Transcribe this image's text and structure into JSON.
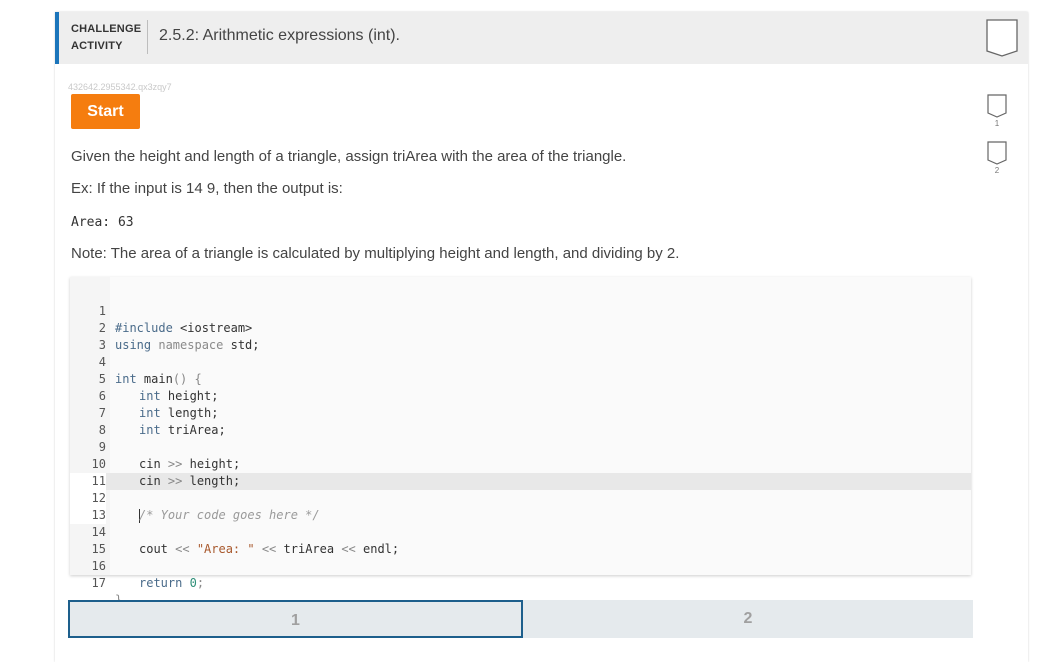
{
  "header": {
    "label_line1": "CHALLENGE",
    "label_line2": "ACTIVITY",
    "title": "2.5.2: Arithmetic expressions (int)."
  },
  "progress_id": "432642.2955342.qx3zqy7",
  "start_label": "Start",
  "levels": [
    {
      "label": "1"
    },
    {
      "label": "2"
    }
  ],
  "description": {
    "prompt": "Given the height and length of a triangle, assign triArea with the area of the triangle.",
    "example": "Ex: If the input is 14 9, then the output is:",
    "output": "Area: 63",
    "note": "Note: The area of a triangle is calculated by multiplying height and length, and dividing by 2."
  },
  "code": {
    "line_numbers": [
      "1",
      "2",
      "3",
      "4",
      "5",
      "6",
      "7",
      "8",
      "9",
      "10",
      "11",
      "12",
      "13",
      "14",
      "15",
      "16",
      "17"
    ],
    "l1_a": "#include ",
    "l1_b": "<iostream>",
    "l2_a": "using ",
    "l2_b": "namespace ",
    "l2_c": "std;",
    "l4_a": "int ",
    "l4_b": "main",
    "l4_c": "() {",
    "l5_a": "int ",
    "l5_b": "height;",
    "l6_a": "int ",
    "l6_b": "length;",
    "l7_a": "int ",
    "l7_b": "triArea;",
    "l9_a": "cin ",
    "l9_b": ">> ",
    "l9_c": "height;",
    "l10_a": "cin ",
    "l10_b": ">> ",
    "l10_c": "length;",
    "l12_a": "/* Your code goes here */",
    "l14_a": "cout ",
    "l14_b": "<< ",
    "l14_c": "\"Area: \"",
    "l14_d": " << ",
    "l14_e": "triArea ",
    "l14_f": "<< ",
    "l14_g": "endl;",
    "l16_a": "return ",
    "l16_b": "0",
    "l16_c": ";",
    "l17_a": "}"
  },
  "nav": {
    "steps": [
      {
        "label": "1"
      },
      {
        "label": "2"
      }
    ],
    "active": "1"
  },
  "colors": {
    "accent_blue": "#1b75bb",
    "start_orange": "#f57d0f",
    "active_border": "#1d5f8c"
  }
}
